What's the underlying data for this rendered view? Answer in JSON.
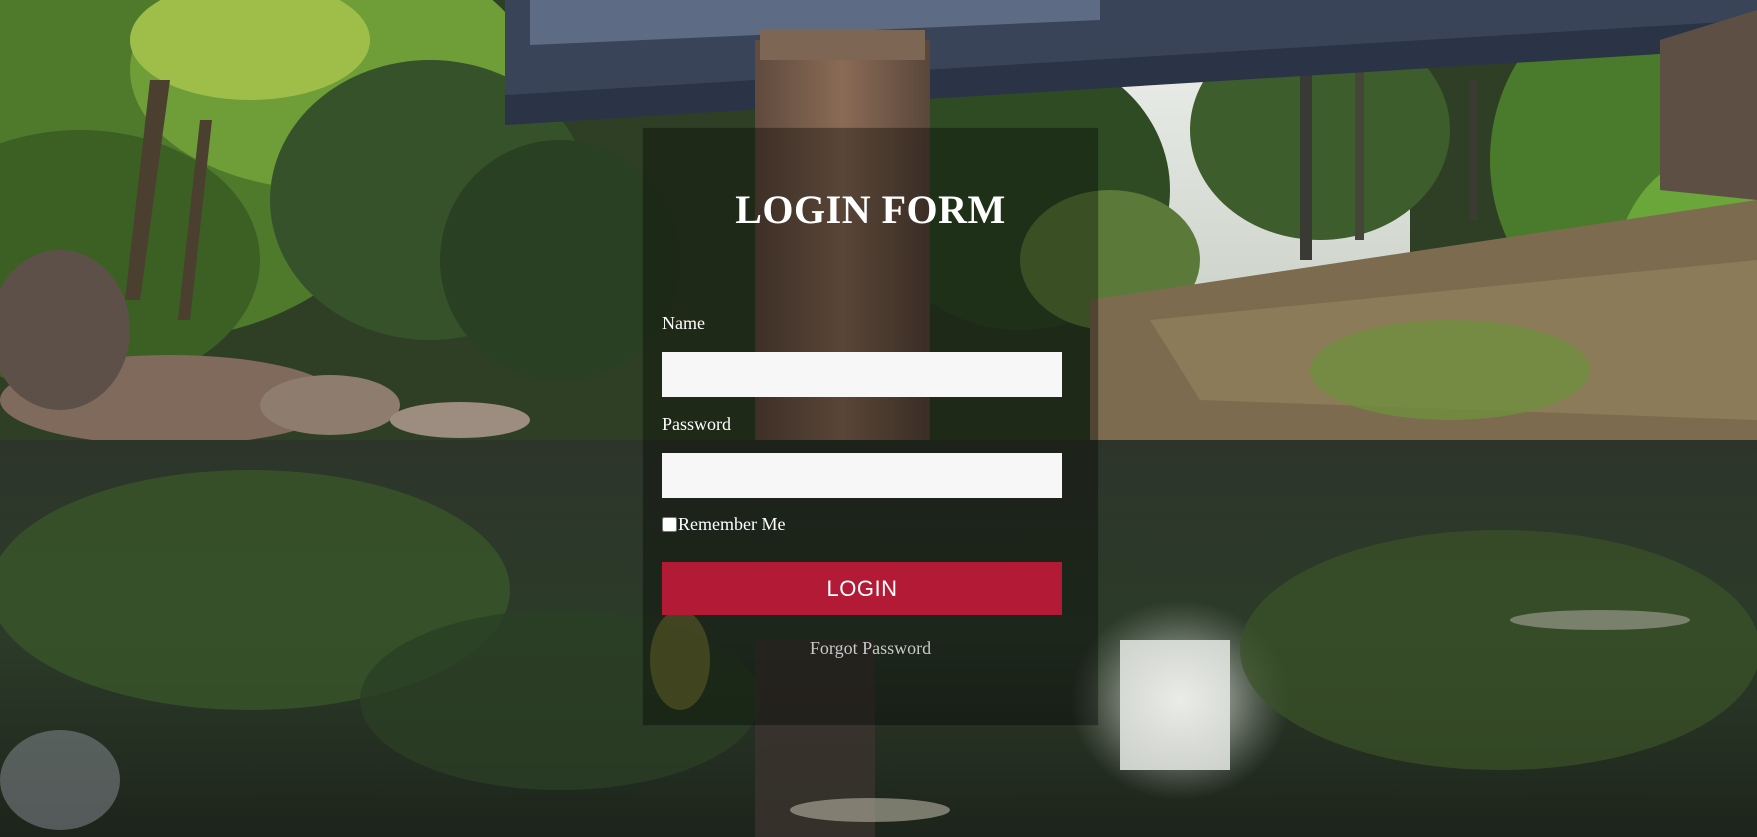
{
  "form": {
    "title": "LOGIN FORM",
    "name_label": "Name",
    "name_value": "",
    "password_label": "Password",
    "password_value": "",
    "remember_label": "Remember Me",
    "remember_checked": false,
    "login_button": "LOGIN",
    "forgot_link": "Forgot Password"
  },
  "colors": {
    "button": "#b31a36",
    "panel_overlay": "rgba(0,0,0,0.35)",
    "link": "#c9c9c9"
  }
}
